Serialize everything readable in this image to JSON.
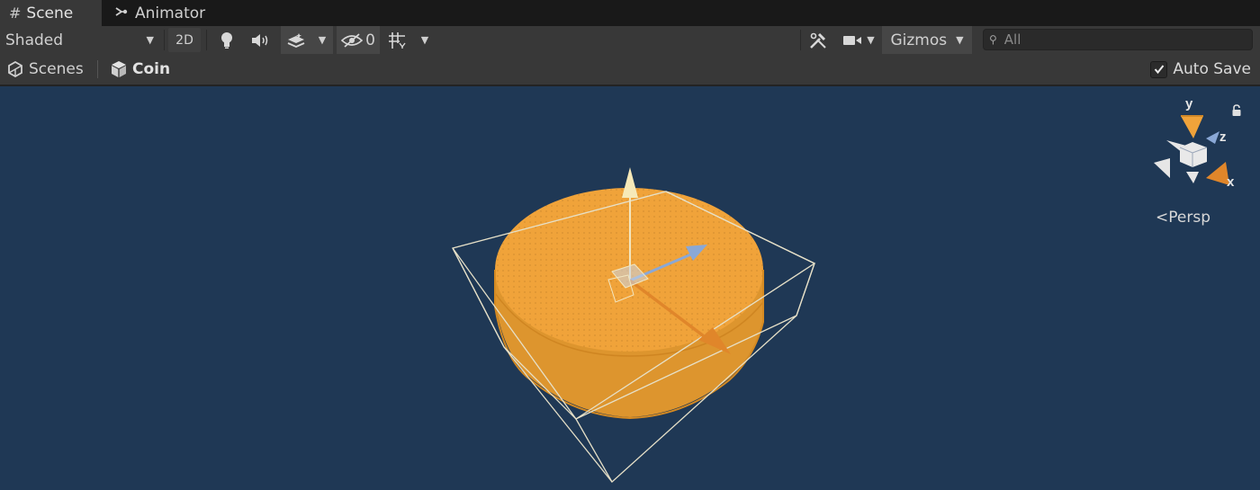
{
  "tabs": [
    {
      "label": "Scene",
      "icon": "scene-grid-icon",
      "active": true
    },
    {
      "label": "Animator",
      "icon": "animator-icon",
      "active": false
    }
  ],
  "toolbar": {
    "draw_mode": "Shaded",
    "mode_2d": "2D",
    "hidden_count": "0",
    "gizmos_label": "Gizmos",
    "search_placeholder": "All"
  },
  "breadcrumb": {
    "root": "Scenes",
    "current": "Coin"
  },
  "autosave": {
    "label": "Auto Save",
    "checked": true
  },
  "viewport": {
    "background_color": "#1f3855",
    "selected_object_color": "#e89a2c",
    "projection_label": "Persp",
    "axis_labels": {
      "x": "x",
      "y": "y",
      "z": "z"
    }
  }
}
